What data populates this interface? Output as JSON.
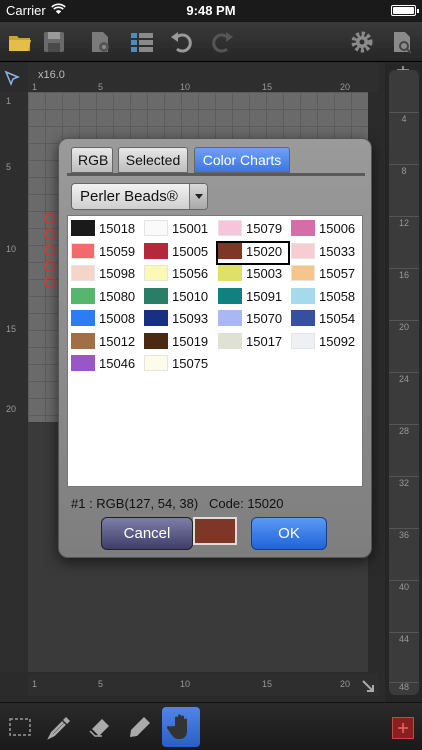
{
  "status_bar": {
    "carrier": "Carrier",
    "time": "9:48 PM"
  },
  "canvas": {
    "zoom": "x16.0",
    "ruler_top": [
      "1",
      "5",
      "10",
      "15",
      "20"
    ],
    "ruler_left": [
      "1",
      "5",
      "10",
      "15",
      "20"
    ],
    "ruler_bottom": [
      "1",
      "5",
      "10",
      "15",
      "20"
    ],
    "ruler_right": [
      "4",
      "8",
      "12",
      "16",
      "20",
      "24",
      "28",
      "32",
      "36",
      "40",
      "44",
      "48"
    ]
  },
  "dialog": {
    "tabs": [
      "RGB",
      "Selected",
      "Color Charts"
    ],
    "active_tab": "Color Charts",
    "palette_select": "Perler Beads®",
    "colors": [
      {
        "code": "15018",
        "hex": "#1a1a1a"
      },
      {
        "code": "15001",
        "hex": "#fafafa"
      },
      {
        "code": "15079",
        "hex": "#f7c4dc"
      },
      {
        "code": "15006",
        "hex": "#d46da8"
      },
      {
        "code": "15059",
        "hex": "#f26a6e"
      },
      {
        "code": "15005",
        "hex": "#b5283c"
      },
      {
        "code": "15020",
        "hex": "#7f3626"
      },
      {
        "code": "15033",
        "hex": "#f6cdd2"
      },
      {
        "code": "15098",
        "hex": "#f5d5c9"
      },
      {
        "code": "15056",
        "hex": "#fbf9b2"
      },
      {
        "code": "15003",
        "hex": "#dfe06a"
      },
      {
        "code": "15057",
        "hex": "#f6c589"
      },
      {
        "code": "15080",
        "hex": "#57b66e"
      },
      {
        "code": "15010",
        "hex": "#2a7e67"
      },
      {
        "code": "15091",
        "hex": "#108080"
      },
      {
        "code": "15058",
        "hex": "#a5daea"
      },
      {
        "code": "15008",
        "hex": "#2b7cf6"
      },
      {
        "code": "15093",
        "hex": "#183080"
      },
      {
        "code": "15070",
        "hex": "#a7b8f5"
      },
      {
        "code": "15054",
        "hex": "#34509e"
      },
      {
        "code": "15012",
        "hex": "#a16f46"
      },
      {
        "code": "15019",
        "hex": "#4a2a12"
      },
      {
        "code": "15017",
        "hex": "#dfe1d4"
      },
      {
        "code": "15092",
        "hex": "#eef0f4"
      },
      {
        "code": "15046",
        "hex": "#9a55c8"
      },
      {
        "code": "15075",
        "hex": "#fdfcea"
      }
    ],
    "selected_code": "15020",
    "info": "#1 : RGB(127, 54, 38)   Code: 15020",
    "selected_hex": "#7f3626",
    "cancel_label": "Cancel",
    "ok_label": "OK"
  }
}
